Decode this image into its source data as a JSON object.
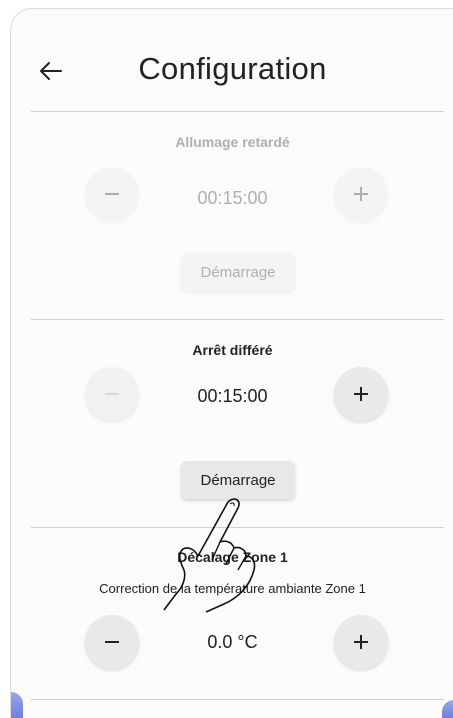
{
  "header": {
    "title": "Configuration",
    "back_icon": "arrow-left-icon"
  },
  "sections": [
    {
      "title": "Allumage retardé",
      "value": "00:15:00",
      "button": "Démarrage",
      "enabled": false
    },
    {
      "title": "Arrêt différé",
      "value": "00:15:00",
      "button": "Démarrage",
      "enabled": true
    },
    {
      "title": "Décalage Zone 1",
      "subtitle": "Correction de la température ambiante Zone 1",
      "value": "0.0 °C"
    }
  ],
  "colors": {
    "text": "#222222",
    "button_bg": "#e9e9e9",
    "divider": "#cfcfcf",
    "accent_corner": "#7f8de3"
  }
}
